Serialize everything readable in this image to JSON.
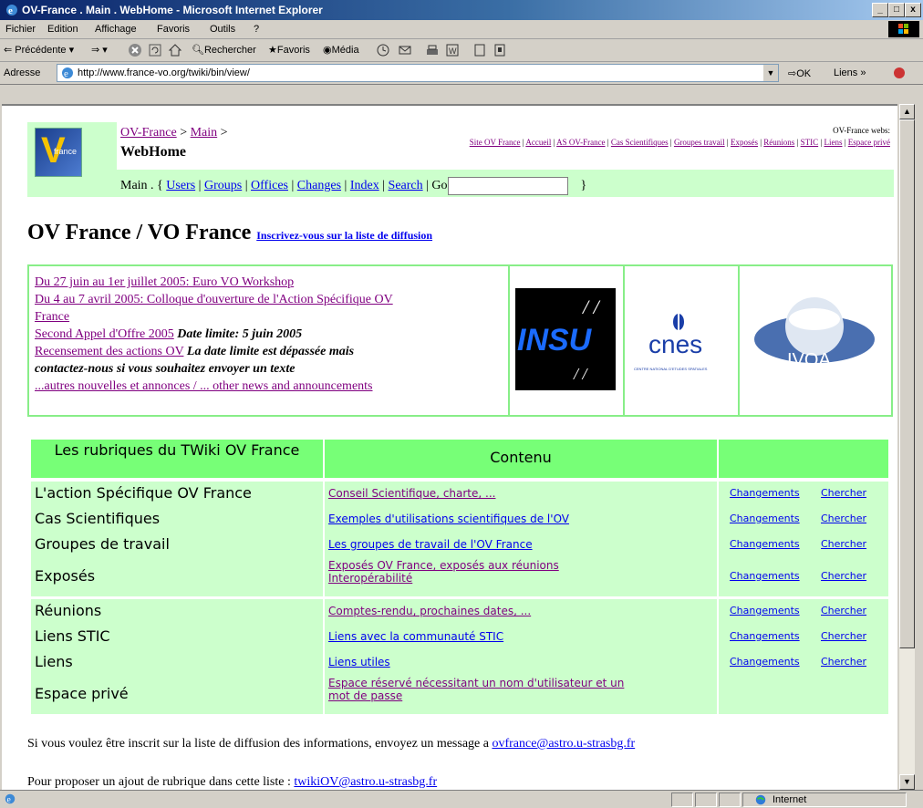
{
  "window": {
    "title": "OV-France . Main . WebHome - Microsoft Internet Explorer",
    "min": "_",
    "max": "□",
    "close": "x"
  },
  "menu": [
    "Fichier",
    "Edition",
    "Affichage",
    "Favoris",
    "Outils",
    "?"
  ],
  "toolbar": {
    "back": "Précédente",
    "search": "Rechercher",
    "favorites": "Favoris",
    "media": "Média"
  },
  "address": {
    "label": "Adresse",
    "url": "http://www.france-vo.org/twiki/bin/view/",
    "go": "OK",
    "links": "Liens"
  },
  "header": {
    "crumb_site": "OV-France",
    "crumb_sep1": " > ",
    "crumb_main": "Main",
    "crumb_sep2": " >",
    "page_name": "WebHome",
    "webs_label": "OV-France webs:",
    "webs": [
      "Site OV France",
      "Accueil",
      "AS OV-France",
      "Cas Scientifiques",
      "Groupes travail",
      "Exposés",
      "Réunions",
      "STIC",
      "Liens",
      "Espace privé"
    ],
    "nav_prefix": "Main . {",
    "nav": [
      "Users",
      "Groups",
      "Offices",
      "Changes",
      "Index",
      "Search"
    ],
    "nav_go": "| Go",
    "nav_suffix": "}"
  },
  "title": {
    "text": "OV France / VO France",
    "link": "Inscrivez-vous sur la liste de diffusion"
  },
  "news": {
    "l1": "Du 27 juin au 1er juillet 2005: Euro VO Workshop",
    "l2": "Du 4 au 7 avril 2005: Colloque d'ouverture de l'Action Spécifique OV",
    "l2b": "France",
    "l3": "Second Appel d'Offre 2005",
    "l3b": "Date limite: 5 juin 2005",
    "l4": "Recensement des actions OV",
    "l4b": "La date limite est dépassée mais",
    "l4c": "contactez-nous si vous souhaitez envoyer un texte",
    "l5": "...autres nouvelles et annonces / ... other news and announcements",
    "logo1": "INSU",
    "logo2": "cnes",
    "logo2_sub": "CENTRE NATIONAL D'ETUDES SPATIALES",
    "logo3": "IVOA"
  },
  "rubriques": {
    "h1": "Les rubriques du TWiki OV France",
    "h2": "Contenu",
    "changes": "Changements",
    "search": "Chercher",
    "rows": [
      {
        "name": "L'action Spécifique OV France",
        "content": "Conseil Scientifique, charte, ...",
        "content2": ""
      },
      {
        "name": "Cas Scientifiques",
        "content": "Exemples d'utilisations scientifiques de l'OV",
        "content2": ""
      },
      {
        "name": "Groupes de travail",
        "content": "Les groupes de travail de l'OV France",
        "content2": ""
      },
      {
        "name": "Exposés",
        "content": "Exposés OV France, exposés aux réunions",
        "content2": "Interopérabilité"
      },
      {
        "name": "Réunions",
        "content": "Comptes-rendu, prochaines dates, ...",
        "content2": ""
      },
      {
        "name": "Liens STIC",
        "content": "Liens avec la communauté STIC",
        "content2": ""
      },
      {
        "name": "Liens",
        "content": "Liens utiles",
        "content2": ""
      },
      {
        "name": "Espace privé",
        "content": "Espace réservé nécessitant un nom d'utilisateur et un",
        "content2": "mot de passe"
      }
    ]
  },
  "footer": {
    "p1": "Si vous voulez être inscrit sur la liste de diffusion des informations, envoyez un message a",
    "p1_mail": "ovfrance@astro.u-strasbg.fr",
    "p2": "Pour proposer un ajout de rubrique dans cette liste :",
    "p2_mail": "twikiOV@astro.u-strasbg.fr"
  },
  "status": {
    "zone": "Internet"
  }
}
